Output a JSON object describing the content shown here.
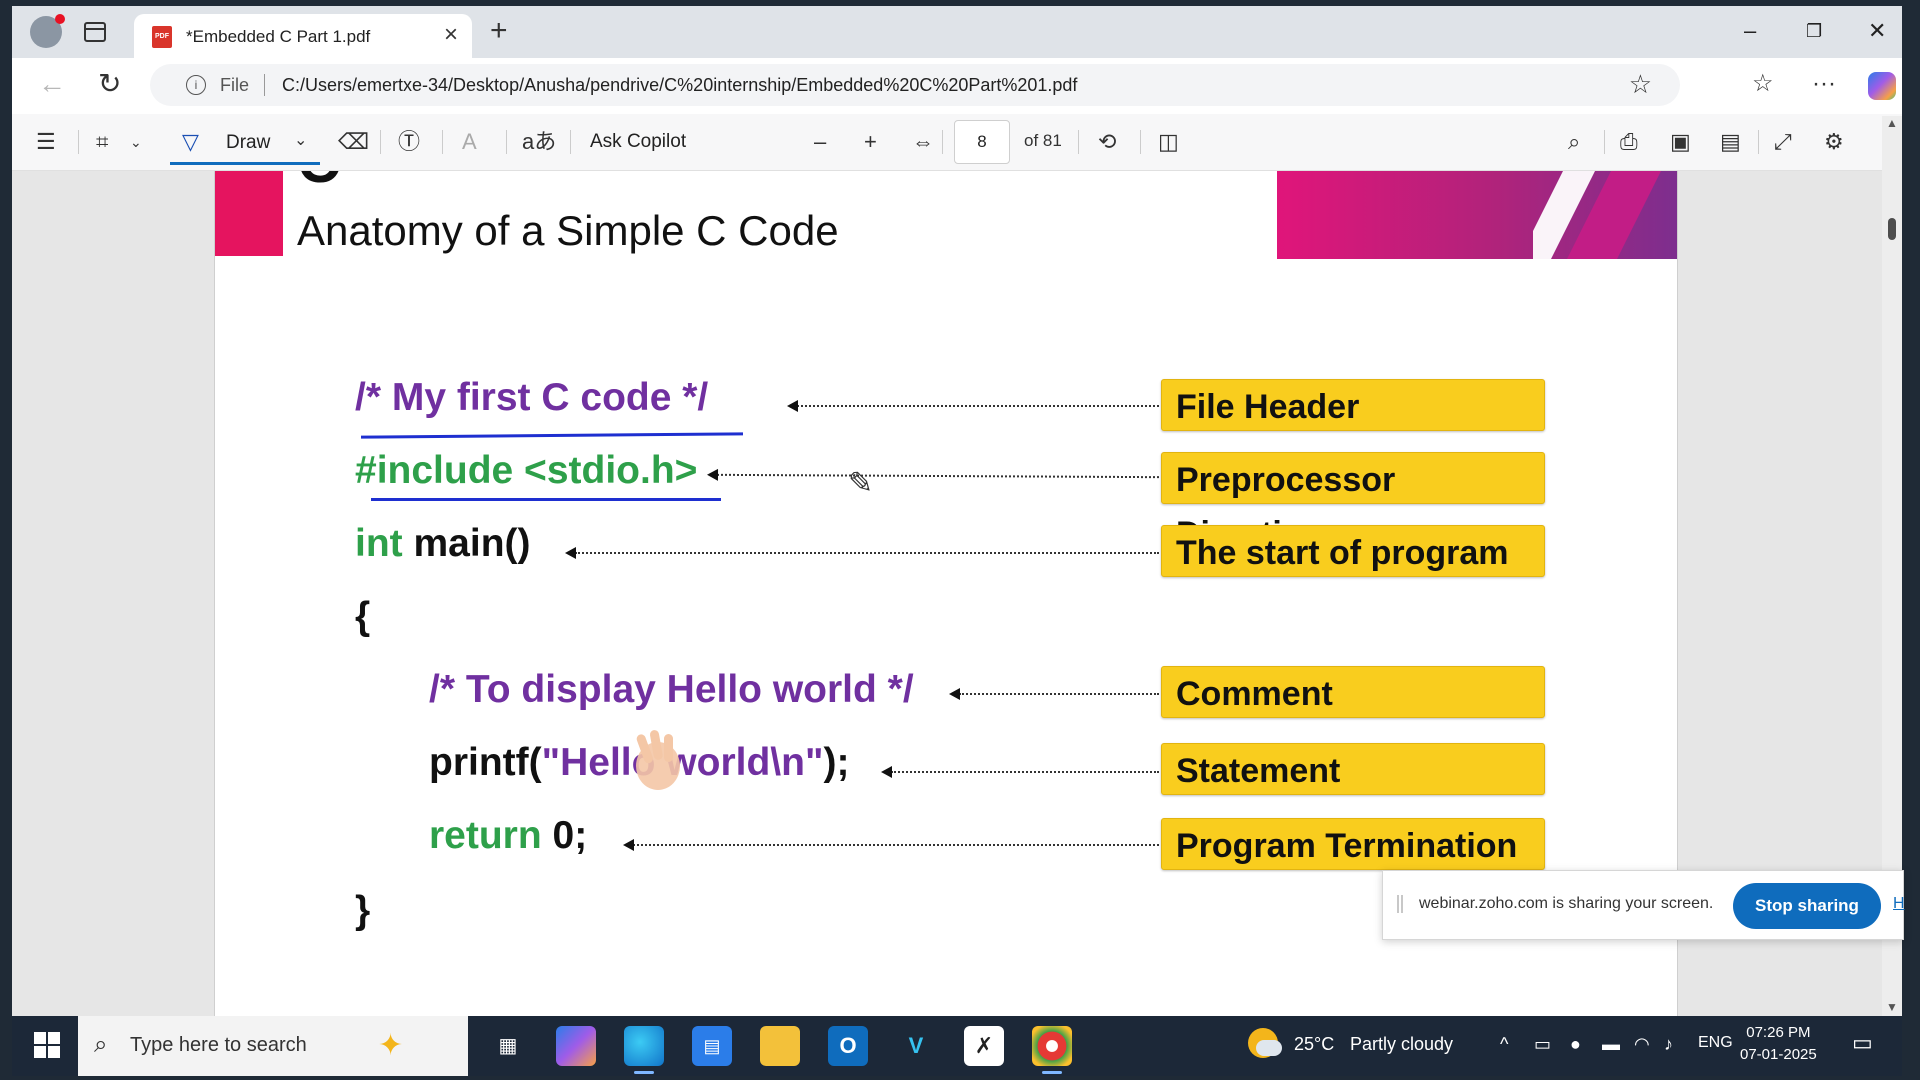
{
  "browser": {
    "tab_title": "*Embedded C Part 1.pdf",
    "address_scheme": "File",
    "url": "C:/Users/emertxe-34/Desktop/Anusha/pendrive/C%20internship/Embedded%20C%20Part%201.pdf"
  },
  "pdf_toolbar": {
    "draw_label": "Draw",
    "ask_copilot_label": "Ask Copilot",
    "page_number": "8",
    "page_total": "of 81"
  },
  "slide": {
    "header_letter": "C",
    "title": "Anatomy of a Simple C Code",
    "code": {
      "line1": "/* My first C code */",
      "line2": "#include <stdio.h>",
      "line3_keyword": "int",
      "line3_rest": " main()",
      "line4": "{",
      "line5": "/* To display Hello world */",
      "line6_fn": "printf(",
      "line6_str": "\"Hello world\\n\"",
      "line6_end": ");",
      "line7_keyword": "return",
      "line7_rest": " 0;",
      "line8": "}"
    },
    "labels": [
      "File Header",
      "Preprocessor Directive",
      "The start of program",
      "Comment",
      "Statement",
      "Program Termination"
    ]
  },
  "sharing": {
    "message": "webinar.zoho.com is sharing your screen.",
    "stop_label": "Stop sharing",
    "hide_label": "H"
  },
  "taskbar": {
    "search_placeholder": "Type here to search",
    "weather_temp": "25°C",
    "weather_desc": "Partly cloudy",
    "language": "ENG",
    "time": "07:26 PM",
    "date": "07-01-2025"
  },
  "colors": {
    "accent": "#0f6cbd",
    "label_bg": "#f9cd1e",
    "code_purple": "#7030a0",
    "code_green": "#2ea04a",
    "title_pink": "#e5145f"
  }
}
